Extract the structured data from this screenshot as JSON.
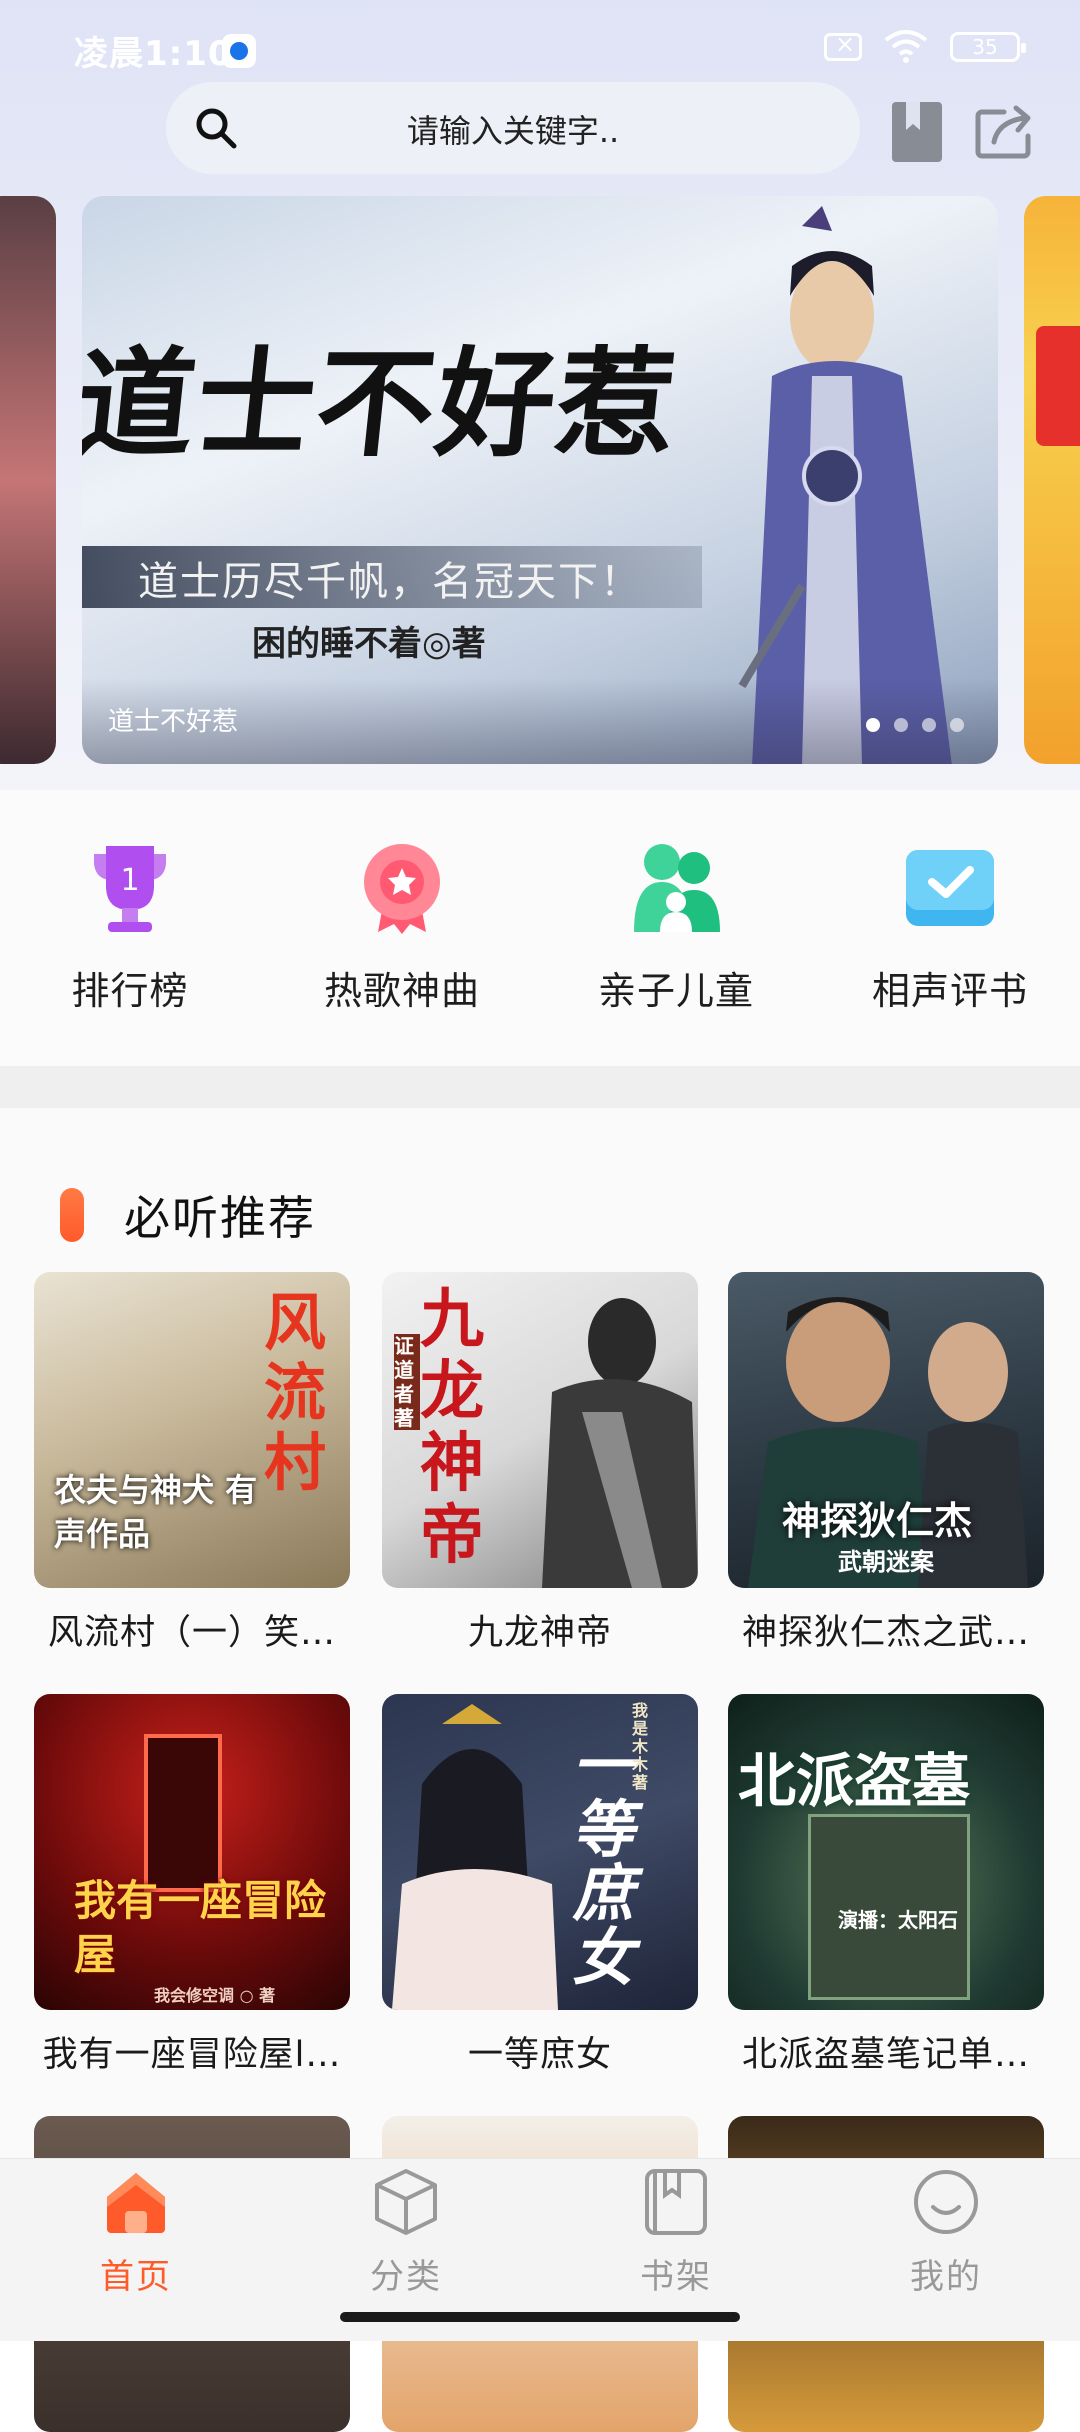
{
  "status_bar": {
    "time": "凌晨1:10",
    "battery": "35"
  },
  "search": {
    "placeholder": "请输入关键字.."
  },
  "banner": {
    "cover_title": "道士不好惹",
    "cover_slogan": "道士历尽千帆，名冠天下！",
    "cover_author": "困的睡不着◎著",
    "caption": "道士不好惹",
    "dot_count": 4,
    "active_dot": 0
  },
  "shortcuts": [
    {
      "label": "排行榜",
      "icon": "trophy-icon"
    },
    {
      "label": "热歌神曲",
      "icon": "medal-icon"
    },
    {
      "label": "亲子儿童",
      "icon": "family-icon"
    },
    {
      "label": "相声评书",
      "icon": "book-check-icon"
    }
  ],
  "recommend": {
    "title": "必听推荐",
    "books": [
      {
        "title": "风流村（一）笑…",
        "cover_title": "风流村",
        "cover_sub": "农夫与神犬 有声作品"
      },
      {
        "title": "九龙神帝",
        "cover_title": "九龙神帝",
        "cover_sub": "证道者 著"
      },
      {
        "title": "神探狄仁杰之武…",
        "cover_title": "神探狄仁杰",
        "cover_sub": "武朝迷案"
      },
      {
        "title": "我有一座冒险屋l…",
        "cover_title": "我有一座冒险屋",
        "cover_sub": "我会修空调 ○ 著"
      },
      {
        "title": "一等庶女",
        "cover_title": "一等庶女",
        "cover_sub": "我是木木 著"
      },
      {
        "title": "北派盗墓笔记单…",
        "cover_title": "北派盗墓",
        "cover_sub": "演播：太阳石"
      }
    ]
  },
  "bottom_nav": [
    {
      "label": "首页",
      "icon": "home-icon",
      "active": true
    },
    {
      "label": "分类",
      "icon": "cube-icon",
      "active": false
    },
    {
      "label": "书架",
      "icon": "bookshelf-icon",
      "active": false
    },
    {
      "label": "我的",
      "icon": "profile-icon",
      "active": false
    }
  ],
  "colors": {
    "accent": "#ff5a2a",
    "inactive": "#999999"
  }
}
